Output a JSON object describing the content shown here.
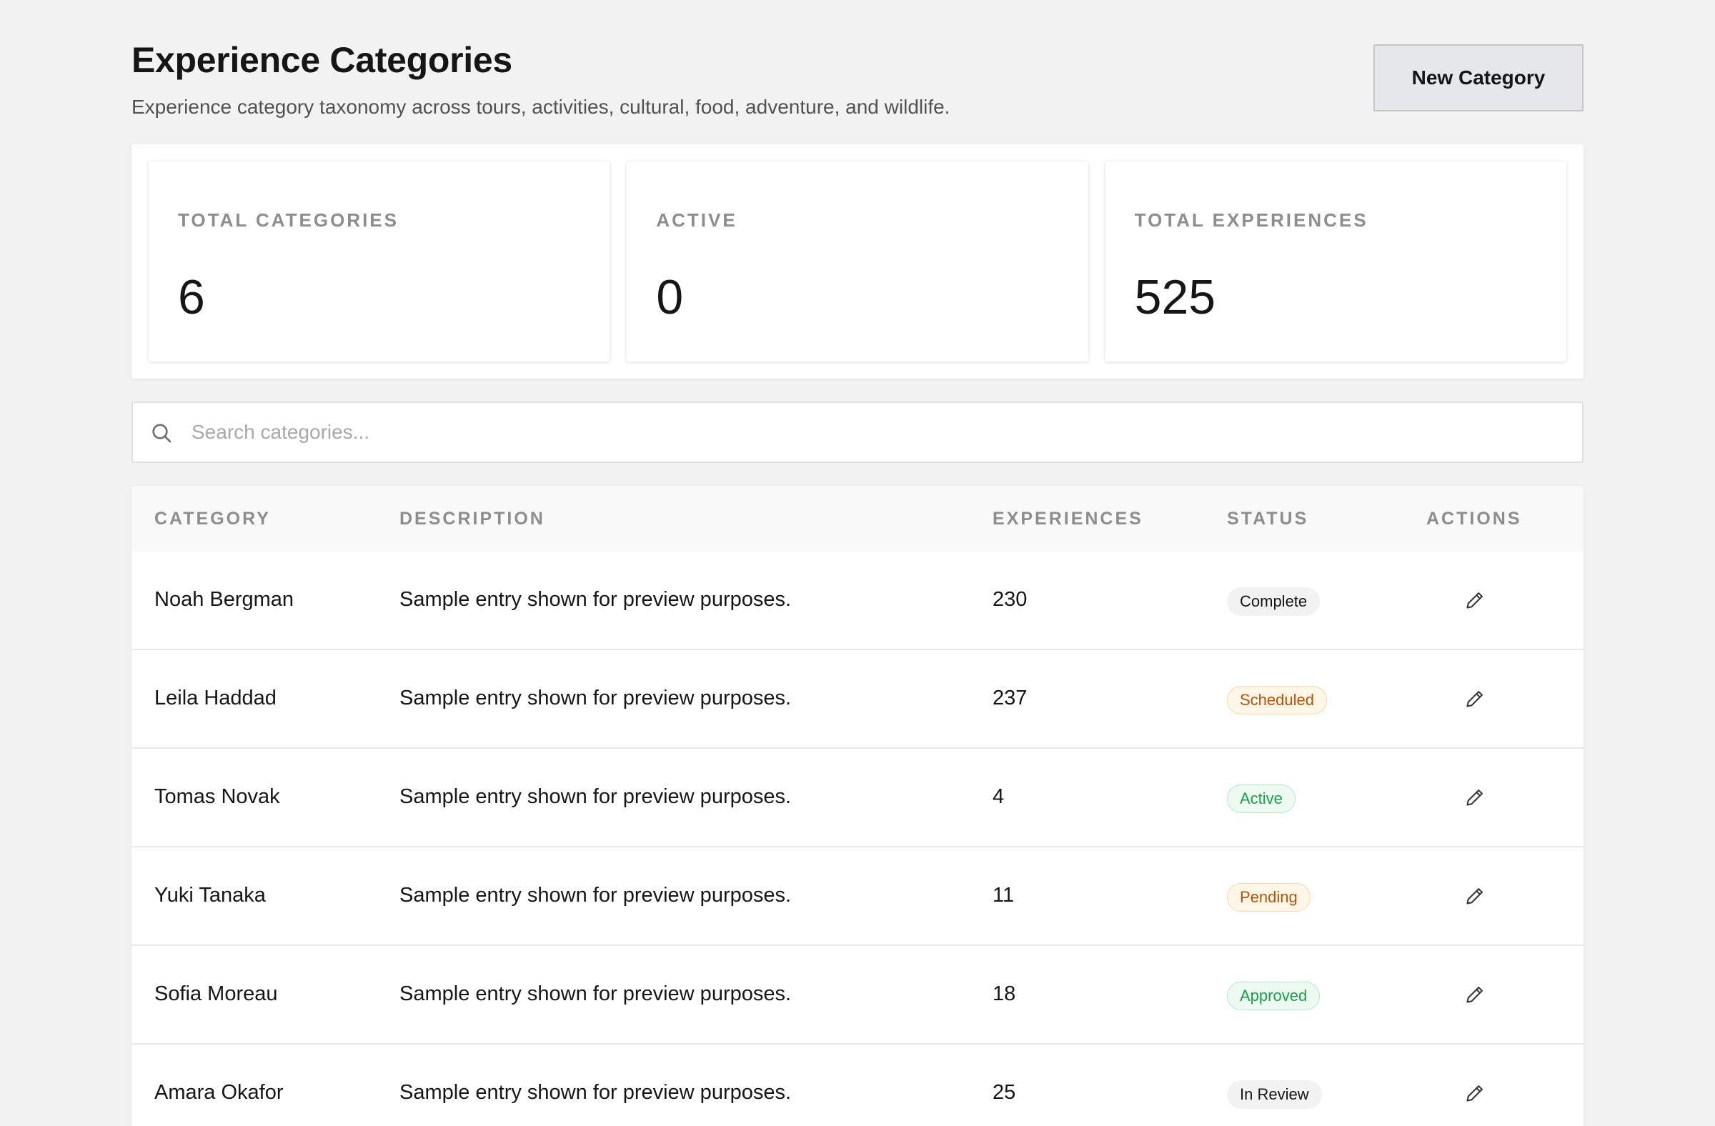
{
  "header": {
    "title": "Experience Categories",
    "subtitle": "Experience category taxonomy across tours, activities, cultural, food, adventure, and wildlife.",
    "new_button_label": "New Category"
  },
  "stats": [
    {
      "label": "TOTAL CATEGORIES",
      "value": "6"
    },
    {
      "label": "ACTIVE",
      "value": "0"
    },
    {
      "label": "TOTAL EXPERIENCES",
      "value": "525"
    }
  ],
  "search": {
    "placeholder": "Search categories...",
    "value": "",
    "icon": "search-icon"
  },
  "table": {
    "columns": {
      "category": "CATEGORY",
      "description": "DESCRIPTION",
      "experiences": "EXPERIENCES",
      "status": "STATUS",
      "actions": "ACTIONS"
    },
    "rows": [
      {
        "category": "Noah Bergman",
        "description": "Sample entry shown for preview purposes.",
        "experiences": "230",
        "status": "Complete",
        "status_tone": "neutral",
        "action_icon": "pencil-icon"
      },
      {
        "category": "Leila Haddad",
        "description": "Sample entry shown for preview purposes.",
        "experiences": "237",
        "status": "Scheduled",
        "status_tone": "warn",
        "action_icon": "pencil-icon"
      },
      {
        "category": "Tomas Novak",
        "description": "Sample entry shown for preview purposes.",
        "experiences": "4",
        "status": "Active",
        "status_tone": "success",
        "action_icon": "pencil-icon"
      },
      {
        "category": "Yuki Tanaka",
        "description": "Sample entry shown for preview purposes.",
        "experiences": "11",
        "status": "Pending",
        "status_tone": "warn",
        "action_icon": "pencil-icon"
      },
      {
        "category": "Sofia Moreau",
        "description": "Sample entry shown for preview purposes.",
        "experiences": "18",
        "status": "Approved",
        "status_tone": "success",
        "action_icon": "pencil-icon"
      },
      {
        "category": "Amara Okafor",
        "description": "Sample entry shown for preview purposes.",
        "experiences": "25",
        "status": "In Review",
        "status_tone": "neutral",
        "action_icon": "pencil-icon"
      }
    ]
  },
  "colors": {
    "background": "#f2f2f2",
    "warn": "#b45309",
    "success": "#16a34a",
    "muted_label": "#8d8d8d"
  }
}
